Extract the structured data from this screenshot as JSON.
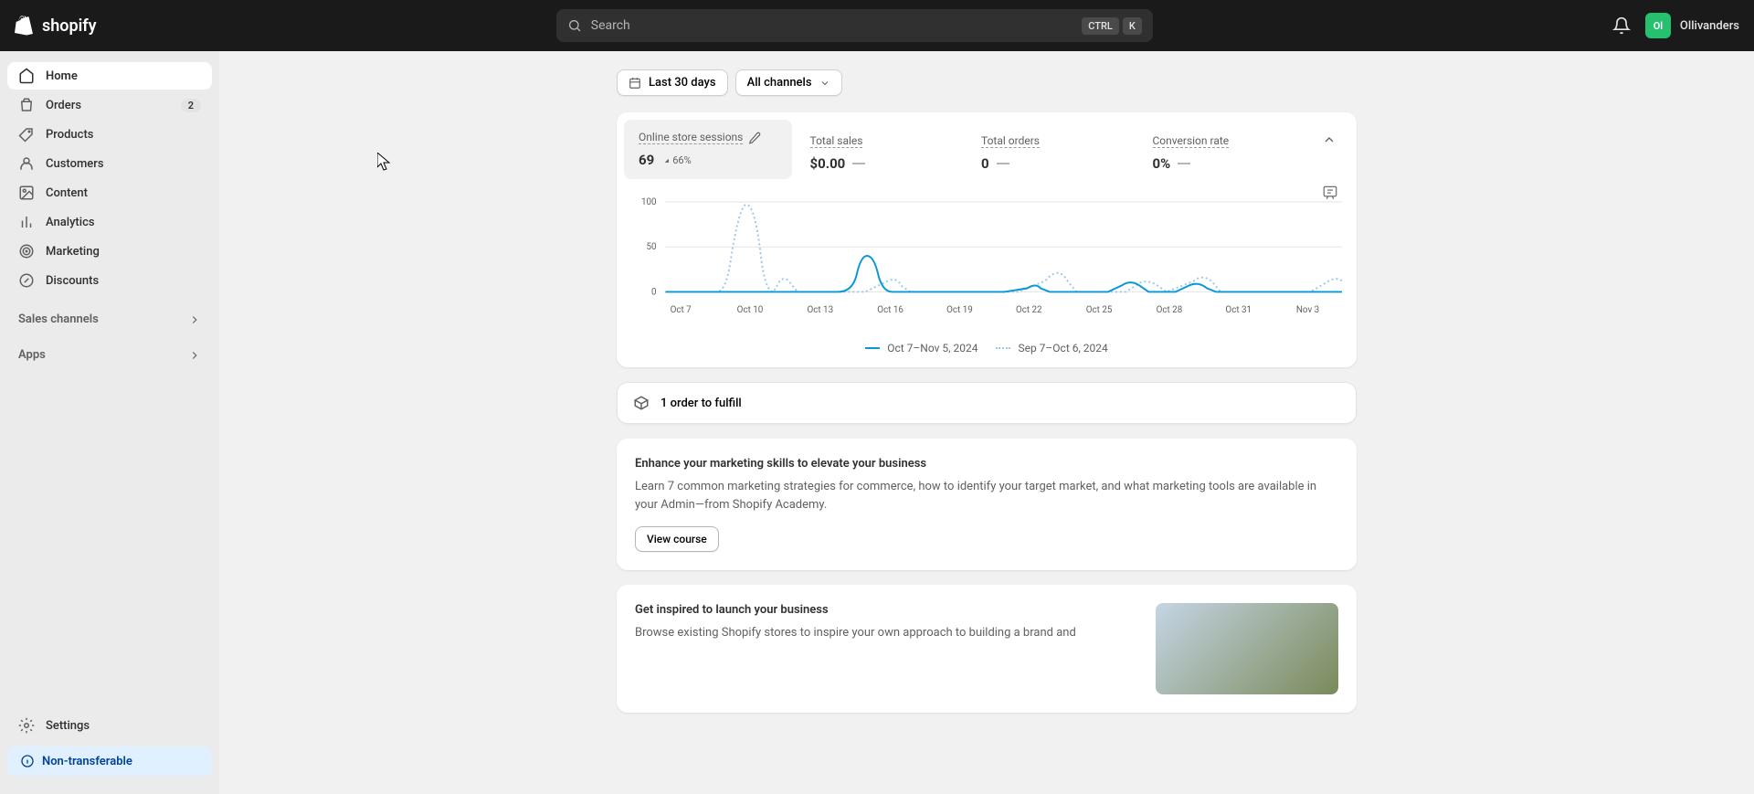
{
  "topbar": {
    "logo_text": "shopify",
    "search_placeholder": "Search",
    "kbd1": "CTRL",
    "kbd2": "K",
    "avatar_initials": "Ol",
    "user_name": "Ollivanders"
  },
  "sidebar": {
    "items": [
      {
        "label": "Home"
      },
      {
        "label": "Orders",
        "badge": "2"
      },
      {
        "label": "Products"
      },
      {
        "label": "Customers"
      },
      {
        "label": "Content"
      },
      {
        "label": "Analytics"
      },
      {
        "label": "Marketing"
      },
      {
        "label": "Discounts"
      }
    ],
    "sales_channels": "Sales channels",
    "apps": "Apps",
    "settings": "Settings",
    "plan": "Non-transferable"
  },
  "controls": {
    "date_range": "Last 30 days",
    "channels": "All channels"
  },
  "stats": {
    "sessions": {
      "title": "Online store sessions",
      "value": "69",
      "delta": "66%"
    },
    "sales": {
      "title": "Total sales",
      "value": "$0.00"
    },
    "orders": {
      "title": "Total orders",
      "value": "0"
    },
    "conversion": {
      "title": "Conversion rate",
      "value": "0%"
    }
  },
  "chart_data": {
    "type": "line",
    "ylabel": "",
    "ylim": [
      0,
      100
    ],
    "y_ticks": [
      0,
      50,
      100
    ],
    "categories": [
      "Oct 7",
      "Oct 10",
      "Oct 13",
      "Oct 16",
      "Oct 19",
      "Oct 22",
      "Oct 25",
      "Oct 28",
      "Oct 31",
      "Nov 3"
    ],
    "series": [
      {
        "name": "Oct 7–Nov 5, 2024",
        "style": "solid",
        "color": "#0a97d5"
      },
      {
        "name": "Sep 7–Oct 6, 2024",
        "style": "dotted",
        "color": "#9bc8ea"
      }
    ],
    "legend": {
      "current": "Oct 7–Nov 5, 2024",
      "previous": "Sep 7–Oct 6, 2024"
    }
  },
  "task": {
    "fulfill": "1 order to fulfill"
  },
  "marketing": {
    "title": "Enhance your marketing skills to elevate your business",
    "text": "Learn 7 common marketing strategies for commerce, how to identify your target market, and what marketing tools are available in your Admin—from Shopify Academy.",
    "button": "View course"
  },
  "inspire": {
    "title": "Get inspired to launch your business",
    "text": "Browse existing Shopify stores to inspire your own approach to building a brand and"
  }
}
